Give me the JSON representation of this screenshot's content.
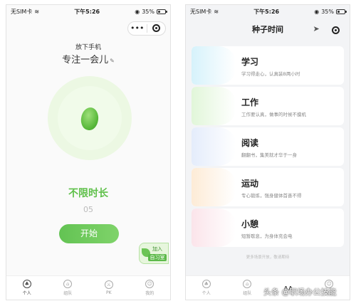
{
  "status_bar": {
    "carrier": "无SIM卡",
    "time": "下午5:26",
    "battery": "35%",
    "battery_level": 0.35
  },
  "left": {
    "subtitle": "放下手机",
    "title": "专注一会儿",
    "mode": "不限时长",
    "minutes": "05",
    "start_label": "开始",
    "join": {
      "line1": "加入",
      "line2": "自习室"
    },
    "capsule": {
      "more": "•••"
    },
    "tabs": [
      {
        "label": "个人",
        "icon": "tree-icon",
        "glyph": "♣"
      },
      {
        "label": "组队",
        "icon": "group-icon",
        "glyph": "⌂"
      },
      {
        "label": "PK",
        "icon": "pk-icon",
        "glyph": "⚔"
      },
      {
        "label": "我的",
        "icon": "profile-icon",
        "glyph": "☺"
      }
    ]
  },
  "right": {
    "nav_title": "种子时间",
    "cards": [
      {
        "title": "学习",
        "desc": "学习得走心，认真装B两小时",
        "color": "#d6f2fb"
      },
      {
        "title": "工作",
        "desc": "工作要认真，做事的时候不摸机",
        "color": "#e1f6d9"
      },
      {
        "title": "阅读",
        "desc": "翻翻书，集美就才华于一身",
        "color": "#e4ecfb"
      },
      {
        "title": "运动",
        "desc": "专心锻炼，强身健体首善不得",
        "color": "#fdebd6"
      },
      {
        "title": "小憩",
        "desc": "短暂歇息，为身体充会电",
        "color": "#fbe4ea"
      }
    ],
    "footer_note": "更多场景开放，敬请期待",
    "tabs": [
      {
        "label": "个人",
        "icon": "tree-icon",
        "glyph": "♣"
      },
      {
        "label": "组队",
        "icon": "group-icon",
        "glyph": "⌂"
      },
      {
        "label": "",
        "icon": "seed-time-icon",
        "glyph": "ᴧᴧ"
      },
      {
        "label": "我的",
        "icon": "profile-icon",
        "glyph": "☺"
      }
    ]
  },
  "watermark": "头条 @职场办公技能",
  "colors": {
    "accent": "#5fc04a",
    "start_button": "#6bc75a"
  }
}
